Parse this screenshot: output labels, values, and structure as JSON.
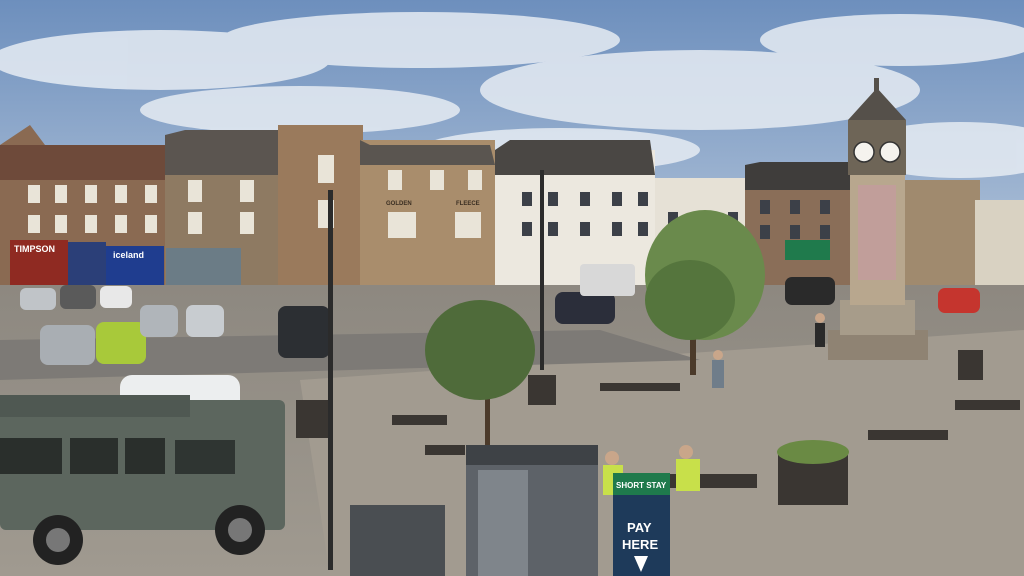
{
  "scene": {
    "description_tag": "town-square-webcam",
    "shop_signs": {
      "timpson": "TIMPSON",
      "iceland": "iceland",
      "golden": "GOLDEN",
      "fleece": "FLEECE"
    },
    "parking_sign": {
      "top": "SHORT STAY",
      "line1": "PAY",
      "line2": "HERE"
    },
    "colors": {
      "sky": "#8fb0d6",
      "cloud": "#e8edf3",
      "brick": "#8a6a52",
      "stone": "#b8a78e",
      "paving": "#8f8a82",
      "tree": "#5f7f45",
      "sign_green": "#1f7a4c",
      "sign_navy": "#1e3a5a",
      "landrover": "#5c665e"
    }
  }
}
